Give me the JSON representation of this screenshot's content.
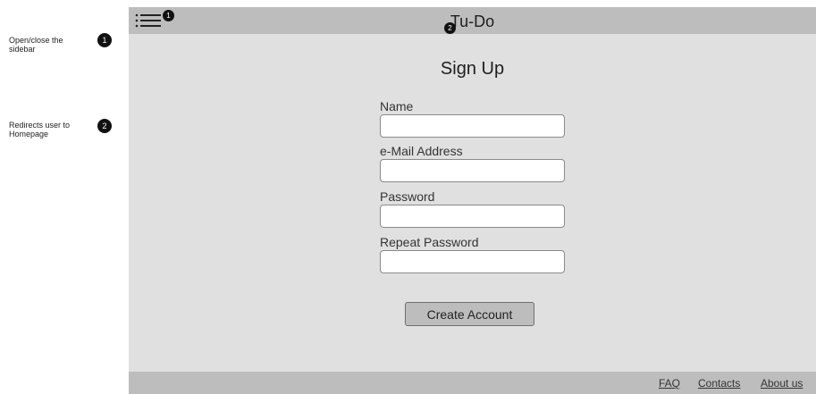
{
  "annotations": [
    {
      "number": "1",
      "text": "Open/close the sidebar"
    },
    {
      "number": "2",
      "text": "Redirects user to Homepage"
    }
  ],
  "header": {
    "app_title": "Tu-Do",
    "menu_icon": "hamburger-list-icon"
  },
  "main": {
    "page_title": "Sign Up",
    "fields": [
      {
        "label": "Name",
        "value": "",
        "placeholder": ""
      },
      {
        "label": "e-Mail Address",
        "value": "",
        "placeholder": ""
      },
      {
        "label": "Password",
        "value": "",
        "placeholder": ""
      },
      {
        "label": "Repeat Password",
        "value": "",
        "placeholder": ""
      }
    ],
    "submit_label": "Create Account"
  },
  "footer": {
    "links": [
      "FAQ",
      "Contacts",
      "About us"
    ]
  },
  "colors": {
    "topbar": "#bdbdbd",
    "page_background": "#e0e0e0",
    "button": "#bdbdbd",
    "badge": "#111111"
  }
}
